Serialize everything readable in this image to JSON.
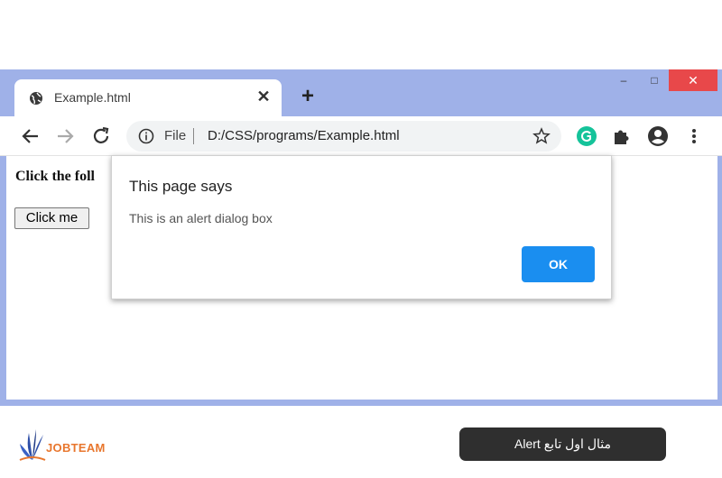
{
  "browser": {
    "tab": {
      "title": "Example.html",
      "favicon": "globe-icon",
      "close": "✕"
    },
    "new_tab": "+",
    "window_controls": {
      "minimize": "–",
      "maximize": "□",
      "close": "✕"
    },
    "address_bar": {
      "scheme_label": "File",
      "url": "D:/CSS/programs/Example.html"
    },
    "colors": {
      "frame": "#9fb1e8",
      "close_button": "#e8484a",
      "ok_button": "#1a8ef0",
      "grammarly": "#15c39a"
    }
  },
  "page": {
    "text": "Click the foll",
    "button_label": "Click me"
  },
  "dialog": {
    "title": "This page says",
    "message": "This is an alert dialog box",
    "ok_label": "OK"
  },
  "footer": {
    "logo_text": "JOBTEAM",
    "caption": "مثال اول تابع Alert"
  }
}
